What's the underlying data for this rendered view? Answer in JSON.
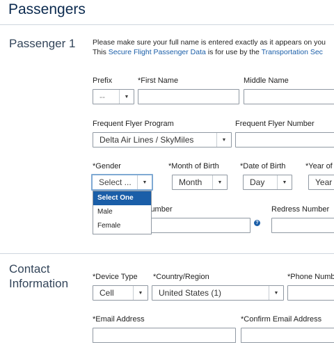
{
  "header": {
    "title": "Passengers"
  },
  "passenger": {
    "section_title": "Passenger 1",
    "notice_line1": "Please make sure your full name is entered exactly as it appears on you",
    "notice_line2_pre": "This ",
    "notice_link1": "Secure Flight Passenger Data",
    "notice_line2_mid": " is for use by the ",
    "notice_link2": "Transportation Sec",
    "prefix_label": "Prefix",
    "prefix_value": "--",
    "first_name_label": "*First Name",
    "middle_name_label": "Middle Name",
    "ffp_label": "Frequent Flyer Program",
    "ffp_value": "Delta Air Lines / SkyMiles",
    "ffn_label": "Frequent Flyer Number",
    "gender_label": "*Gender",
    "gender_value": "Select ...",
    "gender_options": [
      "Select One",
      "Male",
      "Female"
    ],
    "month_label": "*Month of Birth",
    "month_value": "Month",
    "date_label": "*Date of Birth",
    "date_value": "Day",
    "year_label": "*Year of",
    "year_value": "Year",
    "known_traveler_label_partial": "lumber",
    "redress_label": "Redress Number",
    "help_glyph": "?"
  },
  "contact": {
    "section_title_line1": "Contact",
    "section_title_line2": "Information",
    "device_label": "*Device Type",
    "device_value": "Cell",
    "country_label": "*Country/Region",
    "country_value": "United States (1)",
    "phone_label": "*Phone Numb",
    "email_label": "*Email Address",
    "confirm_email_label": "*Confirm Email Address"
  },
  "colors": {
    "accent": "#1a5ea8",
    "title": "#0b2a4f",
    "focus": "#7fa9d3"
  },
  "icons": {
    "dropdown_arrow": "chevron-down-icon",
    "help": "help-icon"
  }
}
